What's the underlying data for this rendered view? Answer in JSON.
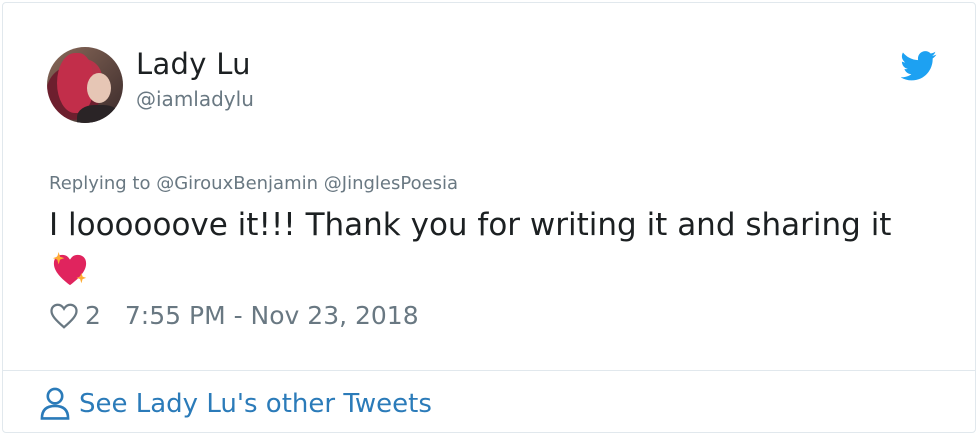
{
  "author": {
    "display_name": "Lady Lu",
    "handle": "@iamladylu",
    "avatar_icon": "avatar-photo"
  },
  "brand": {
    "icon": "twitter-bird-icon",
    "color": "#1da1f2"
  },
  "reply": {
    "prefix": "Replying to",
    "mentions": [
      "@GirouxBenjamin",
      "@JinglesPoesia"
    ],
    "text": "Replying to @GirouxBenjamin @JinglesPoesia"
  },
  "tweet": {
    "text": "I loooooove it!!! Thank you for writing it and sharing it",
    "emoji": "sparkling-heart"
  },
  "meta": {
    "like_icon": "heart-icon",
    "likes": "2",
    "timestamp": "7:55 PM - Nov 23, 2018"
  },
  "footer": {
    "icon": "person-icon",
    "link_text": "See Lady Lu's other Tweets",
    "link_color": "#2b7bb9"
  }
}
